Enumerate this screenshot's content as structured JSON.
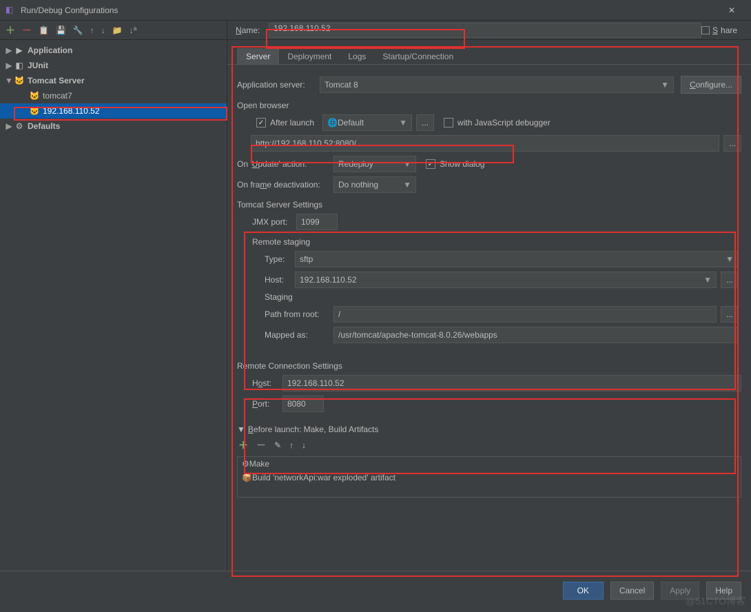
{
  "window": {
    "title": "Run/Debug Configurations"
  },
  "tree": {
    "items": [
      {
        "label": "Application",
        "bold": true,
        "icon": "▶",
        "indent": 0,
        "expander": "▶"
      },
      {
        "label": "JUnit",
        "bold": true,
        "icon": "◧",
        "indent": 0,
        "expander": "▶"
      },
      {
        "label": "Tomcat Server",
        "bold": true,
        "icon": "🐱",
        "indent": 0,
        "expander": "▼"
      },
      {
        "label": "tomcat7",
        "bold": false,
        "icon": "🐱",
        "indent": 1,
        "expander": ""
      },
      {
        "label": "192.168.110.52",
        "bold": false,
        "icon": "🐱",
        "indent": 1,
        "expander": "",
        "selected": true
      },
      {
        "label": "Defaults",
        "bold": true,
        "icon": "⚙",
        "indent": 0,
        "expander": "▶"
      }
    ]
  },
  "name": {
    "label": "Name:",
    "value": "192.168.110.52"
  },
  "share": "Share",
  "tabs": [
    "Server",
    "Deployment",
    "Logs",
    "Startup/Connection"
  ],
  "appServer": {
    "label": "Application server:",
    "value": "Tomcat 8",
    "configure": "Configure..."
  },
  "openBrowser": {
    "title": "Open browser",
    "afterLaunch": "After launch",
    "browser": "Default",
    "jsDebugger": "with JavaScript debugger",
    "url": "http://192.168.110.52:8080/"
  },
  "update": {
    "label": "On 'Update' action:",
    "value": "Redeploy",
    "show": "Show dialog"
  },
  "frame": {
    "label": "On frame deactivation:",
    "value": "Do nothing"
  },
  "tomcat": {
    "title": "Tomcat Server Settings",
    "jmxLabel": "JMX port:",
    "jmx": "1099",
    "remoteStaging": "Remote staging",
    "typeLabel": "Type:",
    "type": "sftp",
    "hostLabel": "Host:",
    "host": "192.168.110.52",
    "staging": "Staging",
    "pathLabel": "Path from root:",
    "path": "/",
    "mappedLabel": "Mapped as:",
    "mapped": "/usr/tomcat/apache-tomcat-8.0.26/webapps"
  },
  "remote": {
    "title": "Remote Connection Settings",
    "hostLabel": "Host:",
    "host": "192.168.110.52",
    "portLabel": "Port:",
    "port": "8080"
  },
  "before": {
    "title": "Before launch: Make, Build Artifacts",
    "items": [
      "Make",
      "Build 'networkApi:war exploded' artifact"
    ]
  },
  "buttons": {
    "ok": "OK",
    "cancel": "Cancel",
    "apply": "Apply",
    "help": "Help"
  },
  "ellipsis": "...",
  "watermark": "@51CTO博客"
}
